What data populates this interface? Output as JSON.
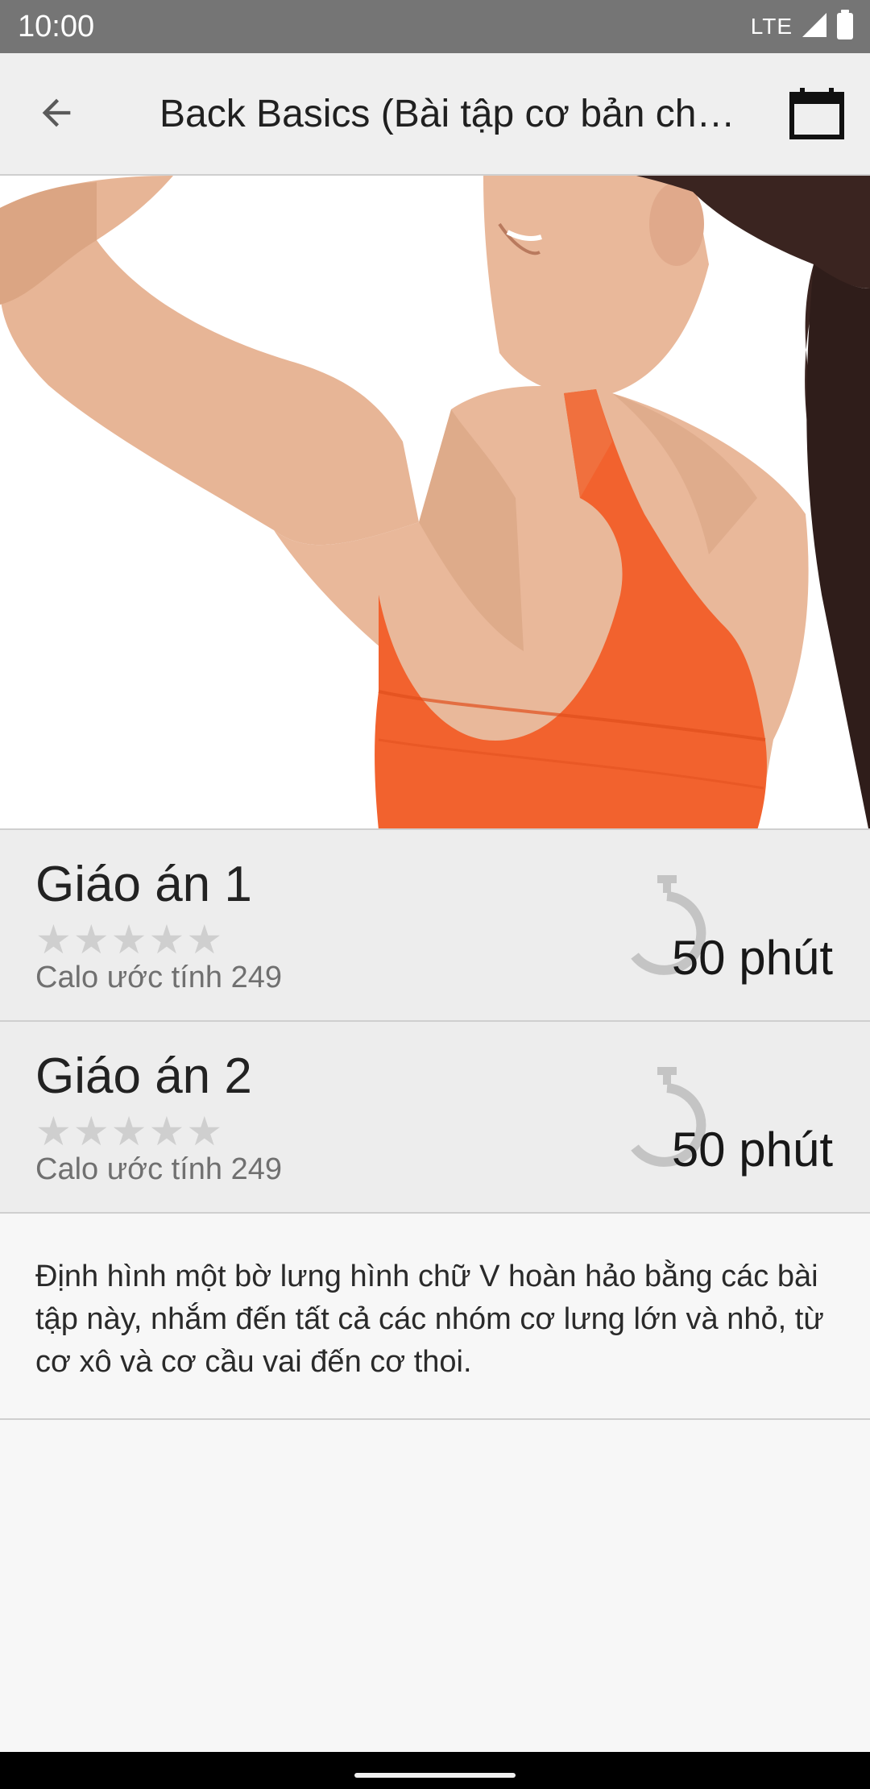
{
  "status_bar": {
    "time": "10:00",
    "network": "LTE"
  },
  "app_bar": {
    "title": "Back Basics (Bài tập cơ bản cho lưng)",
    "back_icon": "arrow-left-icon",
    "calendar_icon": "calendar-icon"
  },
  "hero": {
    "image_subject": "woman in orange tank top flexing back muscles"
  },
  "plans": [
    {
      "name": "Giáo án 1",
      "rating": 0,
      "rating_max": 5,
      "calories": "Calo ước tính 249",
      "duration": "50 phút"
    },
    {
      "name": "Giáo án 2",
      "rating": 0,
      "rating_max": 5,
      "calories": "Calo ước tính 249",
      "duration": "50 phút"
    }
  ],
  "description": "Định hình một bờ lưng hình chữ V hoàn hảo bằng các bài tập này, nhắm đến tất cả các nhóm cơ lưng lớn và nhỏ, từ cơ xô và cơ cầu vai đến cơ thoi.",
  "colors": {
    "status_bar": "#757575",
    "app_bar": "#efefef",
    "row_bg": "#ededed",
    "star_empty": "#cfcfcf",
    "tank_top": "#f2622e",
    "skin": "#e9b89a"
  }
}
